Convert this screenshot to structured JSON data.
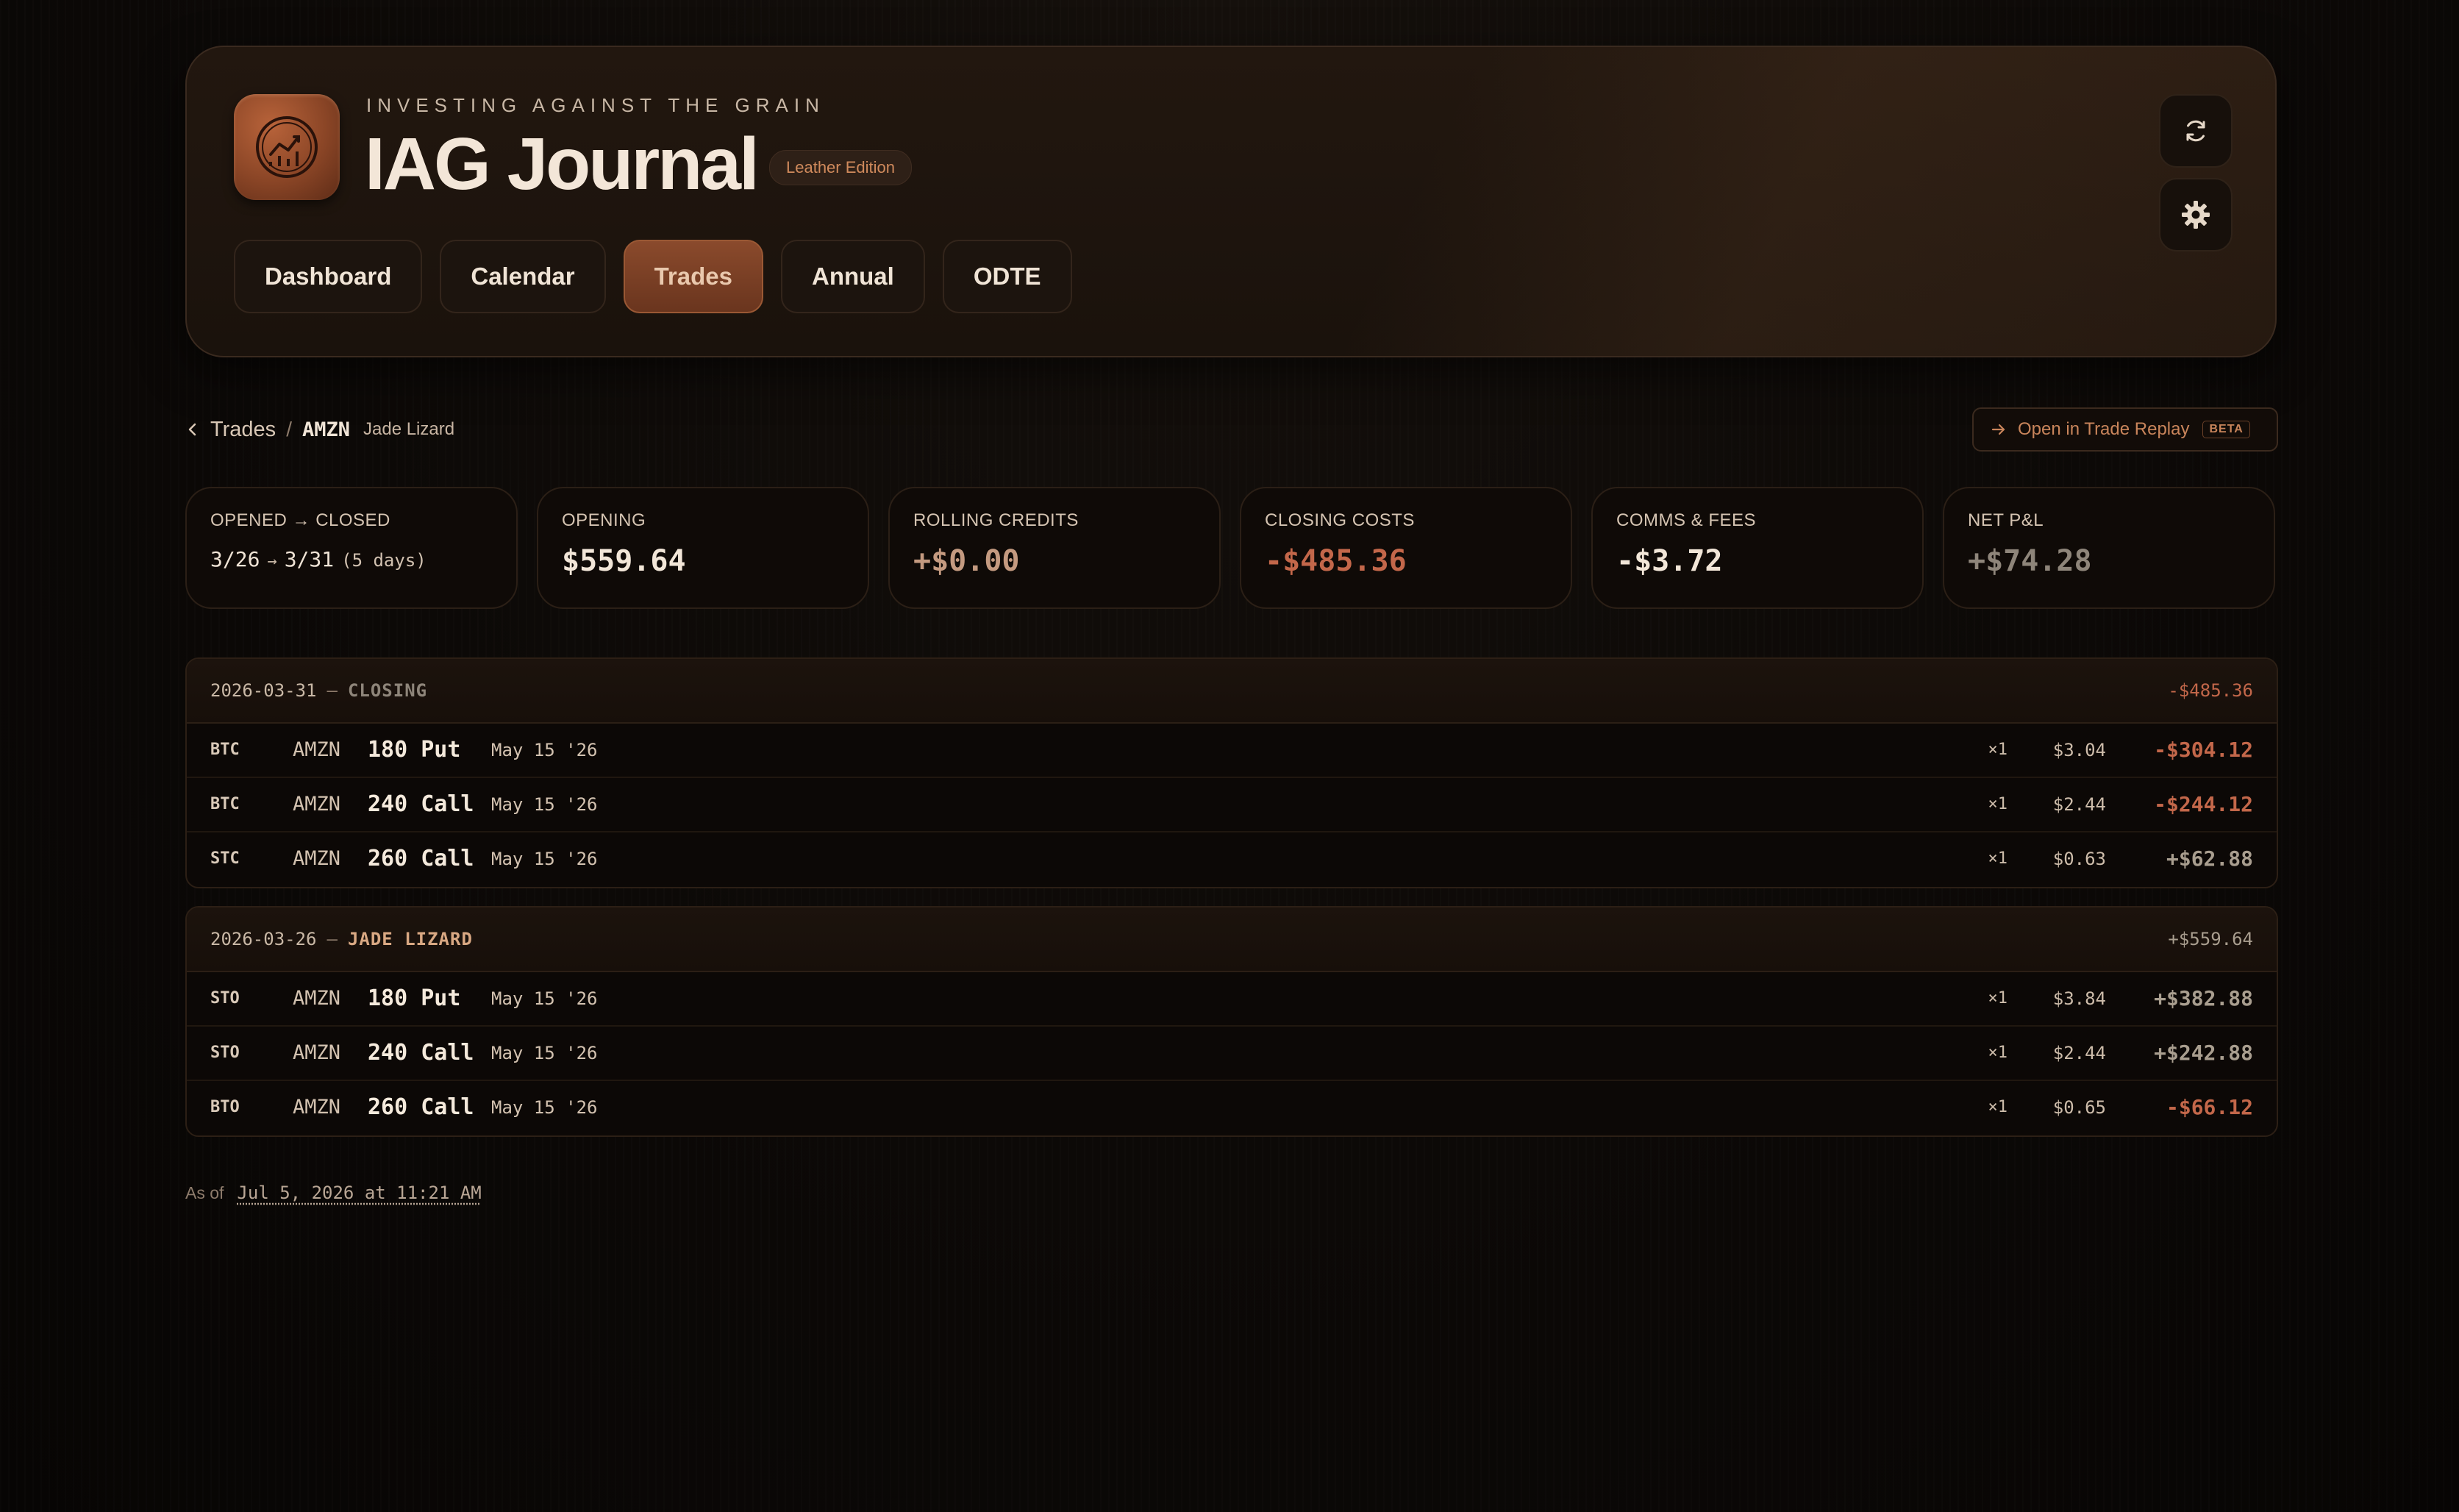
{
  "header": {
    "tagline": "INVESTING AGAINST THE GRAIN",
    "title": "IAG Journal",
    "edition_badge": "Leather Edition",
    "nav_tabs": [
      {
        "label": "Dashboard"
      },
      {
        "label": "Calendar"
      },
      {
        "label": "Trades",
        "active": true
      },
      {
        "label": "Annual"
      },
      {
        "label": "ODTE"
      }
    ],
    "icons": [
      "refresh-icon",
      "settings-gear-icon"
    ]
  },
  "breadcrumb": {
    "back_label": "Trades",
    "separator": "/",
    "symbol": "AMZN",
    "strategy": "Jade Lizard"
  },
  "replay_button": {
    "label": "Open in Trade Replay",
    "badge": "BETA"
  },
  "stats": [
    {
      "label": "OPENED → CLOSED",
      "open": "3/26",
      "arrow": "→",
      "close": "3/31",
      "days": "(5 days)"
    },
    {
      "label": "OPENING",
      "value": "$559.64"
    },
    {
      "label": "ROLLING CREDITS",
      "value": "+$0.00"
    },
    {
      "label": "CLOSING COSTS",
      "value": "-$485.36"
    },
    {
      "label": "COMMS & FEES",
      "value": "-$3.72"
    },
    {
      "label": "NET P&L",
      "value": "+$74.28"
    }
  ],
  "groups": [
    {
      "date": "2026-03-31",
      "dash": "–",
      "type": "CLOSING",
      "total": "-$485.36",
      "legs": [
        {
          "action": "BTC",
          "symbol": "AMZN",
          "strike": "180 Put",
          "expiry": "May 15 '26",
          "qty": "×1",
          "price": "$3.04",
          "amount": "-$304.12"
        },
        {
          "action": "BTC",
          "symbol": "AMZN",
          "strike": "240 Call",
          "expiry": "May 15 '26",
          "qty": "×1",
          "price": "$2.44",
          "amount": "-$244.12"
        },
        {
          "action": "STC",
          "symbol": "AMZN",
          "strike": "260 Call",
          "expiry": "May 15 '26",
          "qty": "×1",
          "price": "$0.63",
          "amount": "+$62.88"
        }
      ]
    },
    {
      "date": "2026-03-26",
      "dash": "–",
      "type": "JADE LIZARD",
      "total": "+$559.64",
      "legs": [
        {
          "action": "STO",
          "symbol": "AMZN",
          "strike": "180 Put",
          "expiry": "May 15 '26",
          "qty": "×1",
          "price": "$3.84",
          "amount": "+$382.88"
        },
        {
          "action": "STO",
          "symbol": "AMZN",
          "strike": "240 Call",
          "expiry": "May 15 '26",
          "qty": "×1",
          "price": "$2.44",
          "amount": "+$242.88"
        },
        {
          "action": "BTO",
          "symbol": "AMZN",
          "strike": "260 Call",
          "expiry": "May 15 '26",
          "qty": "×1",
          "price": "$0.65",
          "amount": "-$66.12"
        }
      ]
    }
  ],
  "footer": {
    "as_of_label": "As of",
    "as_of_value": "Jul 5, 2026 at 11:21 AM"
  },
  "colors": {
    "accent": "#c9855b",
    "negative": "#c3674a",
    "positive": "#a99e8f",
    "background": "#0c0907"
  }
}
